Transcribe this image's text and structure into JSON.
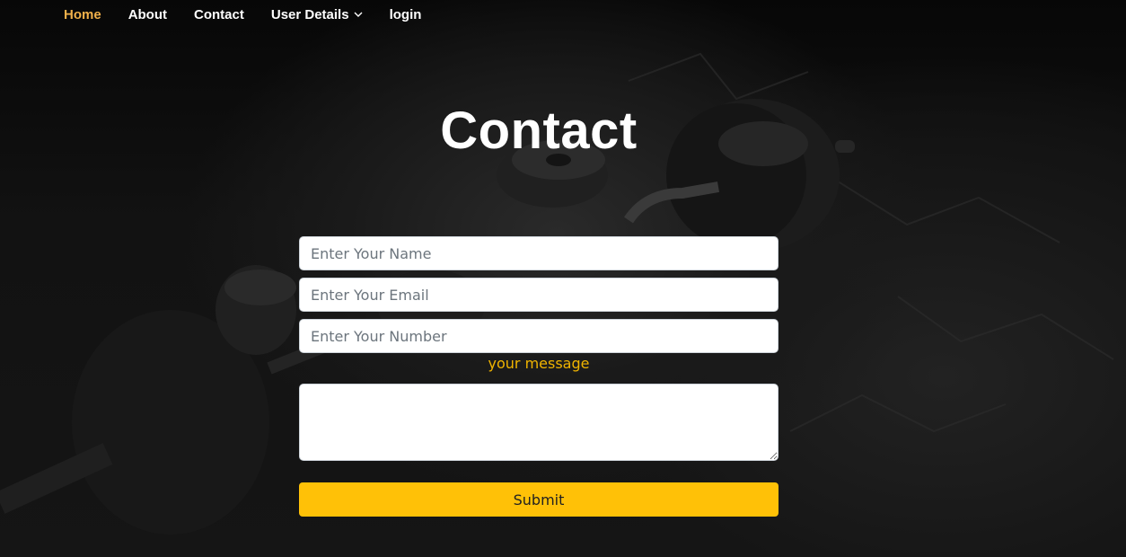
{
  "nav": {
    "items": [
      {
        "label": "Home"
      },
      {
        "label": "About"
      },
      {
        "label": "Contact"
      },
      {
        "label": "User Details"
      },
      {
        "label": "login"
      }
    ]
  },
  "page": {
    "title": "Contact"
  },
  "form": {
    "name_placeholder": "Enter Your Name",
    "email_placeholder": "Enter Your Email",
    "number_placeholder": "Enter Your Number",
    "message_label": "your message",
    "submit_label": "Submit"
  },
  "colors": {
    "accent": "#ffc107",
    "active_nav": "#f0b04a",
    "message_label": "#f0b400"
  },
  "icons": {
    "dropdown": "chevron-down-icon"
  },
  "background": {
    "image": "gym-dumbbells-background"
  }
}
